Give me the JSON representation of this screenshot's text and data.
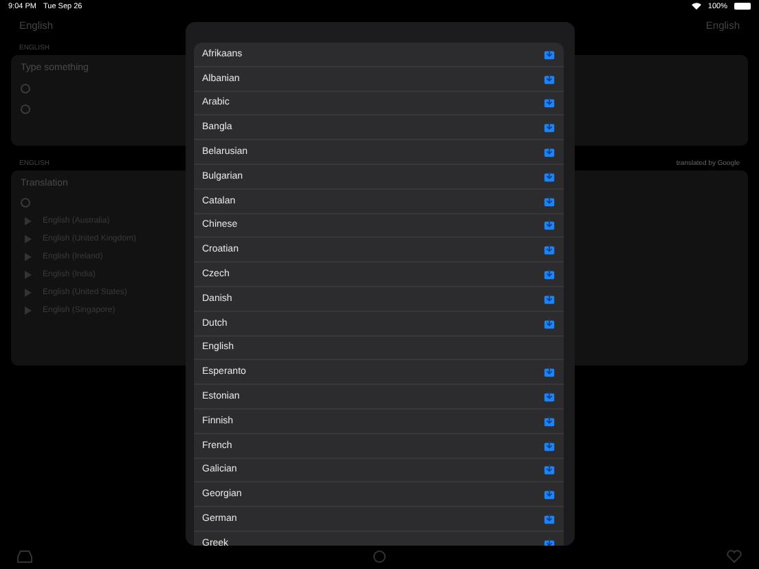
{
  "status_bar": {
    "time": "9:04 PM",
    "date": "Tue Sep 26",
    "battery": "100%"
  },
  "header": {
    "source_language": "English",
    "target_language": "English"
  },
  "input": {
    "label": "ENGLISH",
    "placeholder": "Type something"
  },
  "output": {
    "label": "ENGLISH",
    "attribution": "translated by Google",
    "text": "Translation",
    "voices": [
      "English (Australia)",
      "English (United Kingdom)",
      "English (Ireland)",
      "English (India)",
      "English (United States)",
      "English (Singapore)"
    ]
  },
  "language_picker": {
    "languages": [
      {
        "name": "Afrikaans",
        "downloadable": true
      },
      {
        "name": "Albanian",
        "downloadable": true
      },
      {
        "name": "Arabic",
        "downloadable": true
      },
      {
        "name": "Bangla",
        "downloadable": true
      },
      {
        "name": "Belarusian",
        "downloadable": true
      },
      {
        "name": "Bulgarian",
        "downloadable": true
      },
      {
        "name": "Catalan",
        "downloadable": true
      },
      {
        "name": "Chinese",
        "downloadable": true
      },
      {
        "name": "Croatian",
        "downloadable": true
      },
      {
        "name": "Czech",
        "downloadable": true
      },
      {
        "name": "Danish",
        "downloadable": true
      },
      {
        "name": "Dutch",
        "downloadable": true
      },
      {
        "name": "English",
        "downloadable": false
      },
      {
        "name": "Esperanto",
        "downloadable": true
      },
      {
        "name": "Estonian",
        "downloadable": true
      },
      {
        "name": "Finnish",
        "downloadable": true
      },
      {
        "name": "French",
        "downloadable": true
      },
      {
        "name": "Galician",
        "downloadable": true
      },
      {
        "name": "Georgian",
        "downloadable": true
      },
      {
        "name": "German",
        "downloadable": true
      },
      {
        "name": "Greek",
        "downloadable": true
      }
    ]
  }
}
